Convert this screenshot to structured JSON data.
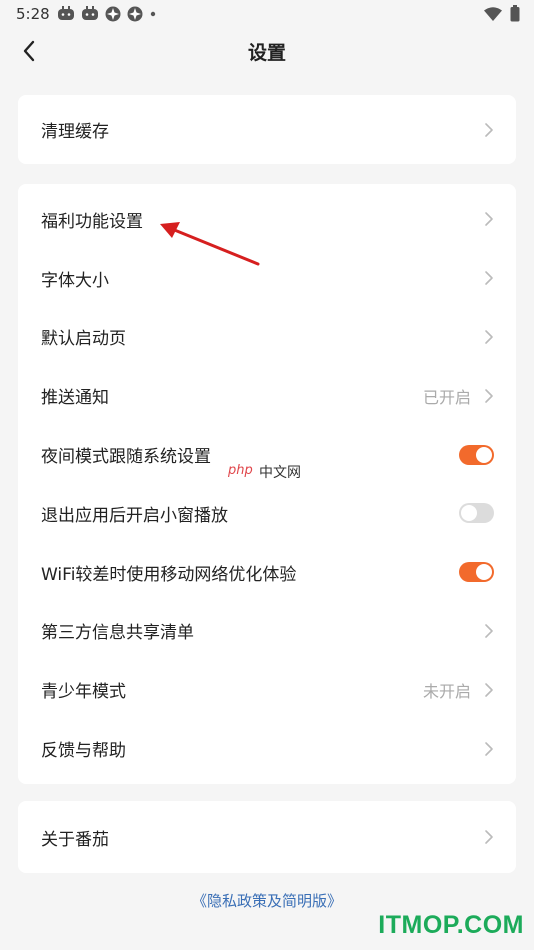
{
  "status_bar": {
    "time": "5:28",
    "left_icons": [
      "game-controller-icon",
      "game-controller-icon",
      "app-icon",
      "app-icon",
      "dot-icon"
    ],
    "right_icons": [
      "wifi-icon",
      "battery-icon"
    ]
  },
  "header": {
    "back_icon": "back-arrow-icon",
    "title": "设置"
  },
  "sections": [
    {
      "items": [
        {
          "label": "清理缓存",
          "control": "chevron"
        }
      ]
    },
    {
      "items": [
        {
          "label": "福利功能设置",
          "control": "chevron"
        },
        {
          "label": "字体大小",
          "control": "chevron"
        },
        {
          "label": "默认启动页",
          "control": "chevron"
        },
        {
          "label": "推送通知",
          "status": "已开启",
          "control": "chevron"
        },
        {
          "label": "夜间模式跟随系统设置",
          "control": "toggle",
          "on": true
        },
        {
          "label": "退出应用后开启小窗播放",
          "control": "toggle",
          "on": false
        },
        {
          "label": "WiFi较差时使用移动网络优化体验",
          "control": "toggle",
          "on": true
        },
        {
          "label": "第三方信息共享清单",
          "control": "chevron"
        },
        {
          "label": "青少年模式",
          "status": "未开启",
          "control": "chevron"
        },
        {
          "label": "反馈与帮助",
          "control": "chevron"
        }
      ]
    },
    {
      "items": [
        {
          "label": "关于番茄",
          "control": "chevron"
        }
      ]
    }
  ],
  "footer": {
    "privacy_link": "《隐私政策及简明版》"
  },
  "watermarks": {
    "php_logo": "php",
    "php_site": "中文网",
    "itmop": "ITMOP.COM"
  },
  "colors": {
    "background": "#f5f5f5",
    "card": "#ffffff",
    "accent": "#f26a2c",
    "toggle_off": "#dcdcdc",
    "link": "#3a6fb6",
    "annotation_arrow": "#d61f1f"
  }
}
